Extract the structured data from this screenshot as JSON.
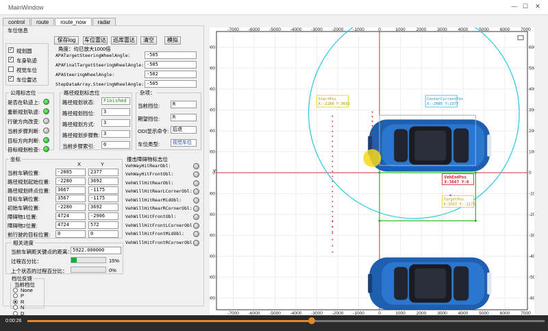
{
  "window": {
    "title": "MainWindow",
    "minimize": "—",
    "maximize": "☐",
    "close": "✕"
  },
  "tabs": [
    "control",
    "route",
    "route_now",
    "radar"
  ],
  "vehicle_info": {
    "title": "车位信息",
    "buttons": {
      "save_log": "保存log",
      "vehicle_radar": "车位雷达",
      "patrol_radar": "巡库雷达",
      "clear": "清空",
      "simulate": "模拟"
    },
    "angle_note": "角度：均已放大1000倍",
    "params": [
      {
        "name": "APATargetSteeringWheelAngle:",
        "value": "-505"
      },
      {
        "name": "APAFinalTargetSteeringWheelAngle:",
        "value": "-505"
      },
      {
        "name": "APASteeringWheelAngle:",
        "value": "-502"
      },
      {
        "name": "StepDataArray.SteeringWheelAngle:",
        "value": "-505"
      }
    ],
    "checkboxes": [
      {
        "label": "规划圆",
        "checked": true
      },
      {
        "label": "车身轨迹",
        "checked": true
      },
      {
        "label": "视觉车位",
        "checked": false
      },
      {
        "label": "车位雷达",
        "checked": true
      }
    ]
  },
  "public_flags": {
    "title": "公用标志位",
    "items": [
      {
        "label": "是否在轨迹上:",
        "state": "green"
      },
      {
        "label": "重新规划轨迹:",
        "state": "green"
      },
      {
        "label": "行驶方向改变:",
        "state": "gray"
      },
      {
        "label": "当前步骤判断:",
        "state": "gray"
      },
      {
        "label": "目标方向判断:",
        "state": "green"
      },
      {
        "label": "目标规划检查:",
        "state": "green"
      }
    ]
  },
  "route_flags": {
    "title": "路径规划标志位",
    "items": [
      {
        "label": "路径规划状态:",
        "value": "Finished"
      },
      {
        "label": "路径规划挡位:",
        "value": "3"
      },
      {
        "label": "路径规划方式:",
        "value": "3"
      },
      {
        "label": "路径规划步骤数:",
        "value": "3"
      },
      {
        "label": "当前步骤索引:",
        "value": "0"
      }
    ]
  },
  "misc": {
    "title": "杂项：",
    "items": [
      {
        "label": "当前挡位:",
        "value": "R"
      },
      {
        "label": "期望挡位:",
        "value": "R"
      },
      {
        "label": "ODI显示命令:",
        "value": "后退"
      },
      {
        "label": "车位类型:",
        "value": "视觉车位"
      }
    ]
  },
  "coords": {
    "title": "坐标",
    "col_x": "X",
    "col_y": "Y",
    "rows": [
      {
        "label": "当前车辆位置:",
        "x": "-2085",
        "y": "2377"
      },
      {
        "label": "路径规划起始位置:",
        "x": "-2280",
        "y": "3692"
      },
      {
        "label": "路径规划终点位置:",
        "x": "3667",
        "y": "-1175"
      },
      {
        "label": "目标车辆位置:",
        "x": "3567",
        "y": "-1175"
      },
      {
        "label": "初始车辆位置:",
        "x": "-2280",
        "y": "3692"
      },
      {
        "label": "障碍物1位置:",
        "x": "4724",
        "y": "-2906"
      },
      {
        "label": "障碍物2位置:",
        "x": "4724",
        "y": "572"
      },
      {
        "label": "前行驶的目标位置:",
        "x": "0",
        "y": "0"
      }
    ]
  },
  "collision_flags": {
    "title": "撞击障碍物标志位",
    "items": [
      "VehWayHitRearObl:",
      "VehWayHitFrontObl:",
      "VehWillHitRearObl:",
      "VehWillHitRearLCornerObl:",
      "VehWillHitRearMidObl:",
      "VehWillHitRearRCornerObl:",
      "VehWillHitFrontObl:",
      "VehWillHitFrontLCornerObl:",
      "VehWillHitFrontMidObl:",
      "VehWillHitFrontRCornerObl:"
    ]
  },
  "progress": {
    "title": "相关进度",
    "distance_label": "当前车辆距关键点的距离：",
    "distance_value": "5922.000000",
    "route_pct_label": "过程百分比：",
    "route_pct": 15,
    "route_pct_text": "15%",
    "prev_pct_label": "上个状态的过程百分比：",
    "prev_pct": 0,
    "prev_pct_text": "0%"
  },
  "gear_feedback": {
    "title": "档位反馈",
    "subtitle": "当前档位",
    "options": [
      "None",
      "P",
      "R",
      "N",
      "D"
    ],
    "selected": "R"
  },
  "plot": {
    "x_ticks": [
      "-7000",
      "-6000",
      "-5000",
      "-4000",
      "-3000",
      "-2000",
      "-1000",
      "0",
      "1000",
      "2000",
      "3000",
      "4000",
      "5000",
      "6000",
      "7000"
    ],
    "y_ticks": [
      "6000",
      "5000",
      "4000",
      "3000",
      "2000",
      "1000",
      "0",
      "-1000",
      "-2000",
      "-3000",
      "-4000",
      "-5000",
      "-6000"
    ],
    "y_axis_label": "Y",
    "annot_center": "CenterCurrentPos\nX:-2085 Y:2377",
    "annot_start": "StartPos\nX:-2280 Y:3692",
    "annot_end": "VehEndPos\nX:3667 Y:0",
    "annot_target": "TargetPos\nX:3567 Y:-1175",
    "colors": {
      "circle": "#22c8e0",
      "target_box": "#22b822",
      "axis": "#d03030",
      "annot": "#e8d000"
    }
  },
  "video": {
    "time": "0:00:26",
    "played_fraction": 0.55
  }
}
